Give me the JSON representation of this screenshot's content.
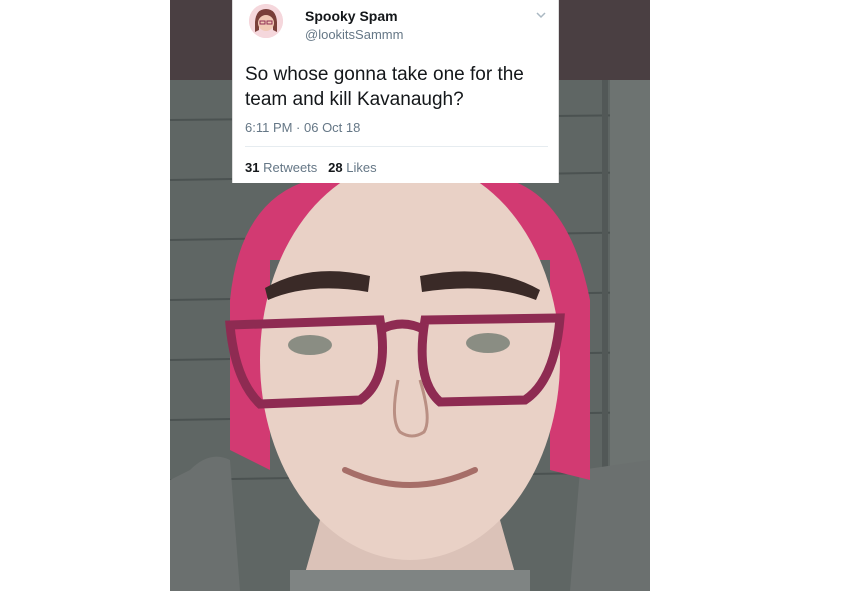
{
  "tweet": {
    "display_name": "Spooky Spam",
    "handle": "@lookitsSammm",
    "text": "So whose gonna take one for the team and kill Kavanaugh?",
    "timestamp": "6:11 PM · 06 Oct 18",
    "retweets_count": "31",
    "retweets_label": "Retweets",
    "likes_count": "28",
    "likes_label": "Likes"
  },
  "icons": {
    "avatar": "avatar-icon",
    "menu": "chevron-down-icon"
  },
  "colors": {
    "hair": "#e23d7a",
    "glasses": "#8e2b52",
    "background": "#4a3f42"
  }
}
